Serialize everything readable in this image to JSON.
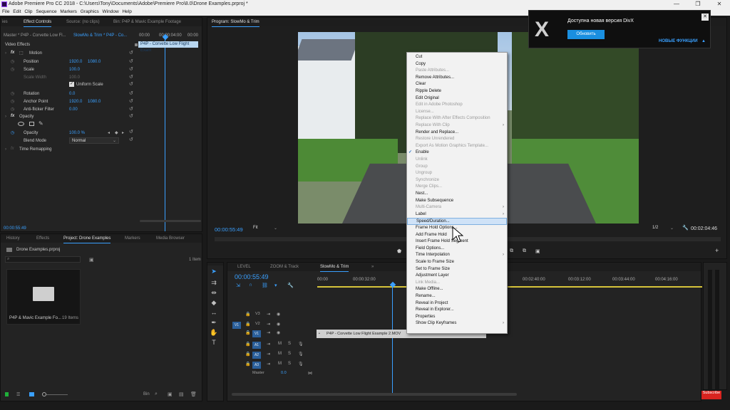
{
  "window": {
    "title": "Adobe Premiere Pro CC 2018 - C:\\Users\\Tony\\Documents\\Adobe\\Premiere Pro\\8.0\\Drone Examples.prproj *",
    "minimize": "—",
    "maximize": "❐",
    "close": "✕"
  },
  "menu": [
    "File",
    "Edit",
    "Clip",
    "Sequence",
    "Markers",
    "Graphics",
    "Window",
    "Help"
  ],
  "top_tabs": {
    "edge": "ies",
    "effect_controls": "Effect Controls",
    "source": "Source: (no clips)",
    "bin": "Bin: P4P & Mavic Example Footage",
    "program": "Program: SlowMo & Trim"
  },
  "effect_controls": {
    "master": "Master * P4P - Corvette Low Fl...",
    "sequence": "SlowMo & Trim * P4P - Co...",
    "ruler_start": "00:00",
    "ruler_mid": "00:00:04:00",
    "ruler_end": "00:00",
    "clip_label": "P4P - Corvette Low Flight Exam",
    "video_effects": "Video Effects",
    "motion": "Motion",
    "position_label": "Position",
    "position_x": "1920.0",
    "position_y": "1080.0",
    "scale_label": "Scale",
    "scale_value": "100.0",
    "scale_width_label": "Scale Width",
    "scale_width_value": "100.0",
    "uniform_scale": "Uniform Scale",
    "rotation_label": "Rotation",
    "rotation_value": "0.0",
    "anchor_label": "Anchor Point",
    "anchor_x": "1920.0",
    "anchor_y": "1080.0",
    "flicker_label": "Anti-flicker Filter",
    "flicker_value": "0.00",
    "opacity": "Opacity",
    "opacity_label": "Opacity",
    "opacity_value": "100.0 %",
    "blend_label": "Blend Mode",
    "blend_value": "Normal",
    "time_remap": "Time Remapping",
    "timecode": "00:00:55:49"
  },
  "project_panel": {
    "tabs": [
      "History",
      "Effects",
      "Project: Drone Examples",
      "Markers",
      "Media Browser"
    ],
    "file": "Drone Examples.prproj",
    "item_count": "1 Item",
    "bin_name": "P4P & Mavic Example Fo...",
    "bin_items": "19 Items",
    "bin_label": "Bin"
  },
  "program_monitor": {
    "timecode": "00:00:55:49",
    "fit": "Fit",
    "resolution": "1/2",
    "duration": "00:02:04:46"
  },
  "timeline": {
    "tabs": [
      "LEVEL",
      "ZOOM & Track",
      "SlowMo & Trim"
    ],
    "timecode": "00:00:55:49",
    "ruler": [
      "00:00",
      "00:00:32:00",
      "00:02:40:00",
      "00:03:12:00",
      "00:03:44:00",
      "00:04:16:00"
    ],
    "video_tracks": [
      "V3",
      "V2",
      "V1"
    ],
    "audio_tracks": [
      "A1",
      "A2",
      "A3"
    ],
    "source_v": "V1",
    "clip": "P4P - Corvette Low Flight Example 2.MOV",
    "master_label": "Master",
    "master_value": "0.0",
    "track_m": "M",
    "track_s": "S"
  },
  "context_menu": [
    {
      "label": "Cut",
      "enabled": true
    },
    {
      "label": "Copy",
      "enabled": true
    },
    {
      "label": "Paste Attributes...",
      "enabled": false
    },
    {
      "label": "Remove Attributes...",
      "enabled": true
    },
    {
      "label": "Clear",
      "enabled": true
    },
    {
      "label": "Ripple Delete",
      "enabled": true
    },
    {
      "label": "Edit Original",
      "enabled": true
    },
    {
      "label": "Edit in Adobe Photoshop",
      "enabled": false
    },
    {
      "label": "License...",
      "enabled": false
    },
    {
      "label": "Replace With After Effects Composition",
      "enabled": false
    },
    {
      "label": "Replace With Clip",
      "enabled": false,
      "submenu": true
    },
    {
      "label": "Render and Replace...",
      "enabled": true
    },
    {
      "label": "Restore Unrendered",
      "enabled": false
    },
    {
      "label": "Export As Motion Graphics Template...",
      "enabled": false
    },
    {
      "label": "Enable",
      "enabled": true,
      "checked": true
    },
    {
      "label": "Unlink",
      "enabled": false
    },
    {
      "label": "Group",
      "enabled": false
    },
    {
      "label": "Ungroup",
      "enabled": false
    },
    {
      "label": "Synchronize",
      "enabled": false
    },
    {
      "label": "Merge Clips...",
      "enabled": false
    },
    {
      "label": "Nest...",
      "enabled": true
    },
    {
      "label": "Make Subsequence",
      "enabled": true
    },
    {
      "label": "Multi-Camera",
      "enabled": false,
      "submenu": true
    },
    {
      "label": "Label",
      "enabled": true,
      "submenu": true
    },
    {
      "label": "Speed/Duration...",
      "enabled": true,
      "highlighted": true
    },
    {
      "label": "Frame Hold Options...",
      "enabled": true
    },
    {
      "label": "Add Frame Hold",
      "enabled": true
    },
    {
      "label": "Insert Frame Hold Segment",
      "enabled": true
    },
    {
      "label": "Field Options...",
      "enabled": true
    },
    {
      "label": "Time Interpolation",
      "enabled": true,
      "submenu": true
    },
    {
      "label": "Scale to Frame Size",
      "enabled": true
    },
    {
      "label": "Set to Frame Size",
      "enabled": true
    },
    {
      "label": "Adjustment Layer",
      "enabled": true
    },
    {
      "label": "Link Media...",
      "enabled": false
    },
    {
      "label": "Make Offline...",
      "enabled": true
    },
    {
      "label": "Rename...",
      "enabled": true
    },
    {
      "label": "Reveal in Project",
      "enabled": true
    },
    {
      "label": "Reveal in Explorer...",
      "enabled": true
    },
    {
      "label": "Properties",
      "enabled": true
    },
    {
      "label": "Show Clip Keyframes",
      "enabled": true,
      "submenu": true
    }
  ],
  "notification": {
    "title": "Доступна новая версия DivX",
    "button": "Обновить",
    "link": "НОВЫЕ ФУНКЦИИ",
    "close": "✕"
  },
  "subscribe": "Subscribe",
  "colors": {
    "accent_blue": "#3aa0ff",
    "panel_bg": "#232323",
    "divx_button": "#1a8fe0",
    "subscribe_red": "#d8231f"
  }
}
